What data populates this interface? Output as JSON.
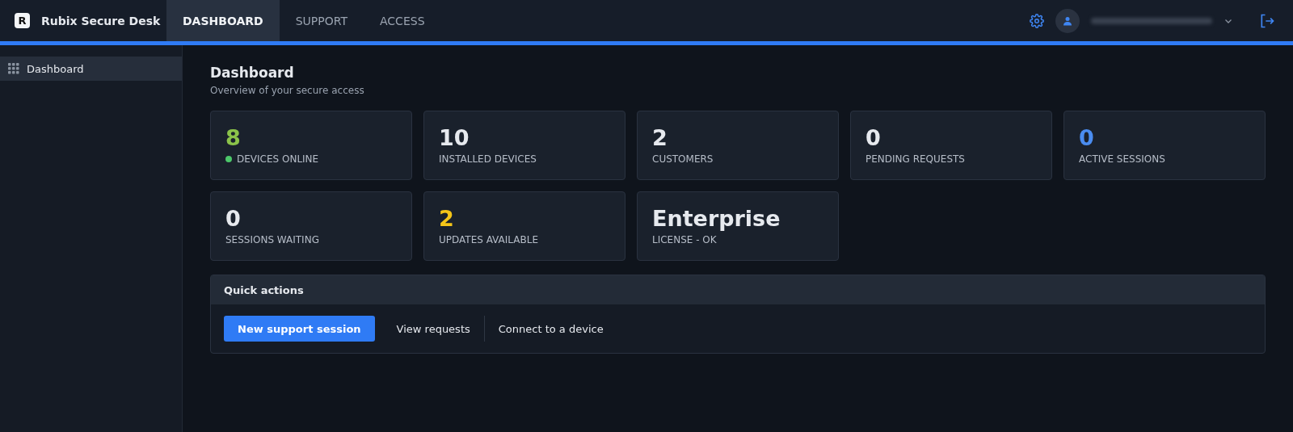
{
  "app": {
    "logo_letter": "R",
    "title": "Rubix Secure Desk"
  },
  "tabs": [
    {
      "label": "DASHBOARD",
      "selected": true
    },
    {
      "label": "SUPPORT",
      "selected": false
    },
    {
      "label": "ACCESS",
      "selected": false
    }
  ],
  "sidebar": {
    "items": [
      {
        "label": "Dashboard",
        "selected": true
      }
    ]
  },
  "page": {
    "title": "Dashboard",
    "subtitle": "Overview of your secure access"
  },
  "stats": [
    {
      "value": "8",
      "label": "DEVICES ONLINE",
      "color": "#8bc34a",
      "status_dot": {
        "color": "#4cc76a"
      }
    },
    {
      "value": "10",
      "label": "INSTALLED DEVICES",
      "color": "#e6e9ee"
    },
    {
      "value": "2",
      "label": "CUSTOMERS",
      "color": "#e6e9ee"
    },
    {
      "value": "0",
      "label": "PENDING REQUESTS",
      "color": "#e6e9ee"
    },
    {
      "value": "0",
      "label": "ACTIVE SESSIONS",
      "color": "#4a8cf0"
    },
    {
      "value": "0",
      "label": "SESSIONS WAITING",
      "color": "#e6e9ee"
    },
    {
      "value": "2",
      "label": "UPDATES AVAILABLE",
      "color": "#f5c518"
    },
    {
      "value": "Enterprise",
      "label": "LICENSE - OK",
      "color": "#e6e9ee"
    }
  ],
  "quick_actions": {
    "title": "Quick actions",
    "actions": [
      {
        "label": "New support session",
        "kind": "primary"
      },
      {
        "label": "View requests",
        "kind": "link"
      },
      {
        "label": "Connect to a device",
        "kind": "link"
      }
    ]
  }
}
